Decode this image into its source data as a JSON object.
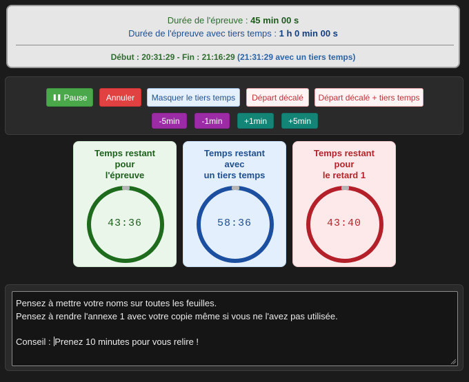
{
  "info": {
    "duree_label": "Durée de l'épreuve : ",
    "duree_value": "45 min 00 s",
    "duree_tt_label": "Durée de l'épreuve avec tiers temps : ",
    "duree_tt_value": "1 h 0 min 00 s",
    "schedule": "Début : 20:31:29 - Fin : 21:16:29",
    "schedule_tt": "(21:31:29 avec un tiers temps)"
  },
  "controls": {
    "pause": "Pause",
    "annuler": "Annuler",
    "masquer": "Masquer le tiers temps",
    "depart": "Départ décalé",
    "depart_tt": "Départ décalé + tiers temps",
    "minus5": "-5min",
    "minus1": "-1min",
    "plus1": "+1min",
    "plus5": "+5min"
  },
  "cards": [
    {
      "title1": "Temps restant",
      "title2": "pour",
      "title3": "l'épreuve",
      "time": "43:36",
      "color": "#1e6b1e"
    },
    {
      "title1": "Temps restant",
      "title2": "avec",
      "title3": "un tiers temps",
      "time": "58:36",
      "color": "#1d4fa0"
    },
    {
      "title1": "Temps restant",
      "title2": "pour",
      "title3": "le retard 1",
      "time": "43:40",
      "color": "#b3202a"
    }
  ],
  "notes": {
    "line1": "Pensez à mettre votre noms sur toutes les feuilles.",
    "line2": "Pensez à rendre l'annexe 1 avec votre copie même si vous ne l'avez pas utilisée.",
    "line3": "",
    "line4_a": "Conseil : ",
    "line4_b": "Prenez 10 minutes pour vous relire !"
  }
}
